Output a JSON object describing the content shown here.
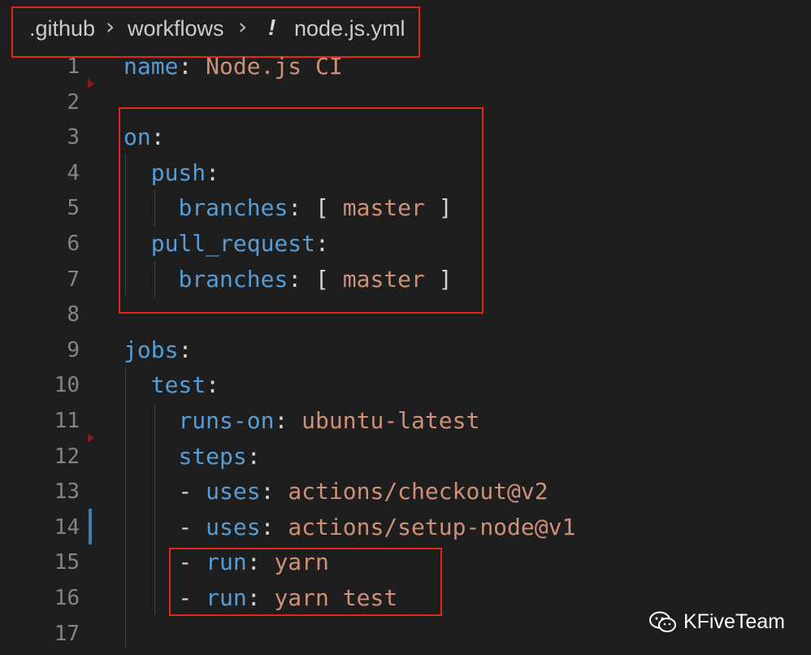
{
  "breadcrumb": {
    "folder1": ".github",
    "folder2": "workflows",
    "file_icon": "!",
    "file": "node.js.yml"
  },
  "lines": [
    {
      "num": "1",
      "tokens": [
        [
          "k",
          "name"
        ],
        [
          "p",
          ": "
        ],
        [
          "v",
          "Node.js CI"
        ]
      ]
    },
    {
      "num": "2",
      "tokens": []
    },
    {
      "num": "3",
      "tokens": [
        [
          "k",
          "on"
        ],
        [
          "p",
          ":"
        ]
      ]
    },
    {
      "num": "4",
      "tokens": [
        [
          "p",
          "  "
        ],
        [
          "k",
          "push"
        ],
        [
          "p",
          ":"
        ]
      ]
    },
    {
      "num": "5",
      "tokens": [
        [
          "p",
          "    "
        ],
        [
          "k",
          "branches"
        ],
        [
          "p",
          ": [ "
        ],
        [
          "v",
          "master"
        ],
        [
          "p",
          " ]"
        ]
      ]
    },
    {
      "num": "6",
      "tokens": [
        [
          "p",
          "  "
        ],
        [
          "k",
          "pull_request"
        ],
        [
          "p",
          ":"
        ]
      ]
    },
    {
      "num": "7",
      "tokens": [
        [
          "p",
          "    "
        ],
        [
          "k",
          "branches"
        ],
        [
          "p",
          ": [ "
        ],
        [
          "v",
          "master"
        ],
        [
          "p",
          " ]"
        ]
      ]
    },
    {
      "num": "8",
      "tokens": []
    },
    {
      "num": "9",
      "tokens": [
        [
          "k",
          "jobs"
        ],
        [
          "p",
          ":"
        ]
      ]
    },
    {
      "num": "10",
      "tokens": [
        [
          "p",
          "  "
        ],
        [
          "k",
          "test"
        ],
        [
          "p",
          ":"
        ]
      ]
    },
    {
      "num": "11",
      "tokens": [
        [
          "p",
          "    "
        ],
        [
          "k",
          "runs-on"
        ],
        [
          "p",
          ": "
        ],
        [
          "v",
          "ubuntu-latest"
        ]
      ]
    },
    {
      "num": "12",
      "tokens": [
        [
          "p",
          "    "
        ],
        [
          "k",
          "steps"
        ],
        [
          "p",
          ":"
        ]
      ]
    },
    {
      "num": "13",
      "tokens": [
        [
          "p",
          "    - "
        ],
        [
          "k",
          "uses"
        ],
        [
          "p",
          ": "
        ],
        [
          "v",
          "actions/checkout@v2"
        ]
      ]
    },
    {
      "num": "14",
      "tokens": [
        [
          "p",
          "    - "
        ],
        [
          "k",
          "uses"
        ],
        [
          "p",
          ": "
        ],
        [
          "v",
          "actions/setup-node@v1"
        ]
      ]
    },
    {
      "num": "15",
      "tokens": [
        [
          "p",
          "    - "
        ],
        [
          "k",
          "run"
        ],
        [
          "p",
          ": "
        ],
        [
          "v",
          "yarn"
        ]
      ]
    },
    {
      "num": "16",
      "tokens": [
        [
          "p",
          "    - "
        ],
        [
          "k",
          "run"
        ],
        [
          "p",
          ": "
        ],
        [
          "v",
          "yarn test"
        ]
      ]
    },
    {
      "num": "17",
      "tokens": []
    }
  ],
  "watermark": {
    "icon": "wechat-icon",
    "text": "KFiveTeam"
  },
  "colors": {
    "key": "#569cd6",
    "string": "#ce9178",
    "punct": "#d4d4d4",
    "highlight_box": "#e0271c"
  }
}
